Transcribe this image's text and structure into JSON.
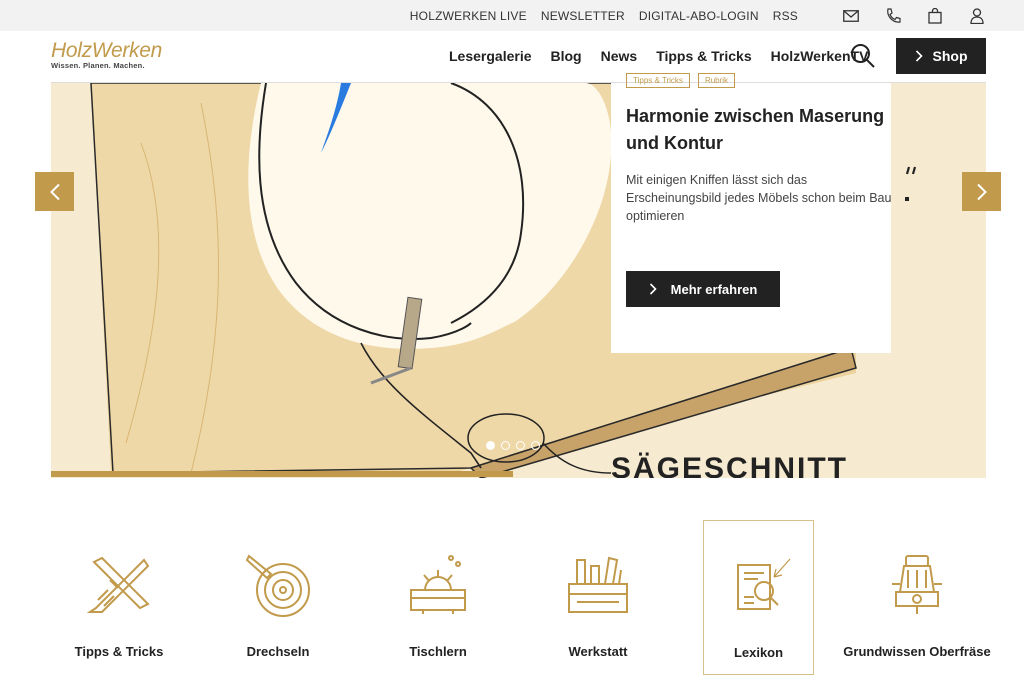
{
  "topbar": {
    "links": [
      "HOLZWERKEN LIVE",
      "NEWSLETTER",
      "DIGITAL-ABO-LOGIN",
      "RSS"
    ],
    "icons": [
      "mail-icon",
      "phone-icon",
      "cart-icon",
      "user-icon"
    ]
  },
  "header": {
    "logo_brand": "HolzWerken",
    "logo_tagline": "Wissen. Planen. Machen.",
    "nav": [
      "Lesergalerie",
      "Blog",
      "News",
      "Tipps & Tricks",
      "HolzWerkenTV"
    ],
    "shop_label": "Shop"
  },
  "hero": {
    "tags": [
      "Tipps & Tricks",
      "Rubrik"
    ],
    "title": "Harmonie zwischen Maserung und Kontur",
    "description": "Mit einigen Kniffen lässt sich das Erscheinungsbild jedes Möbels schon beim Bau optimieren",
    "button_label": "Mehr erfahren",
    "illustration_text": "SÄGESCHNITT",
    "slide_count": 4,
    "active_slide": 1
  },
  "categories": [
    {
      "label": "Tipps & Tricks",
      "icon": "saw-cross-icon"
    },
    {
      "label": "Drechseln",
      "icon": "lathe-icon"
    },
    {
      "label": "Tischlern",
      "icon": "table-saw-icon"
    },
    {
      "label": "Werkstatt",
      "icon": "toolbox-icon"
    },
    {
      "label": "Lexikon",
      "icon": "lexicon-icon",
      "selected": true
    },
    {
      "label": "Grundwissen Oberfräse",
      "icon": "router-icon"
    }
  ],
  "colors": {
    "accent": "#c19a4b",
    "dark": "#222222",
    "wood": "#f3e3c2"
  }
}
